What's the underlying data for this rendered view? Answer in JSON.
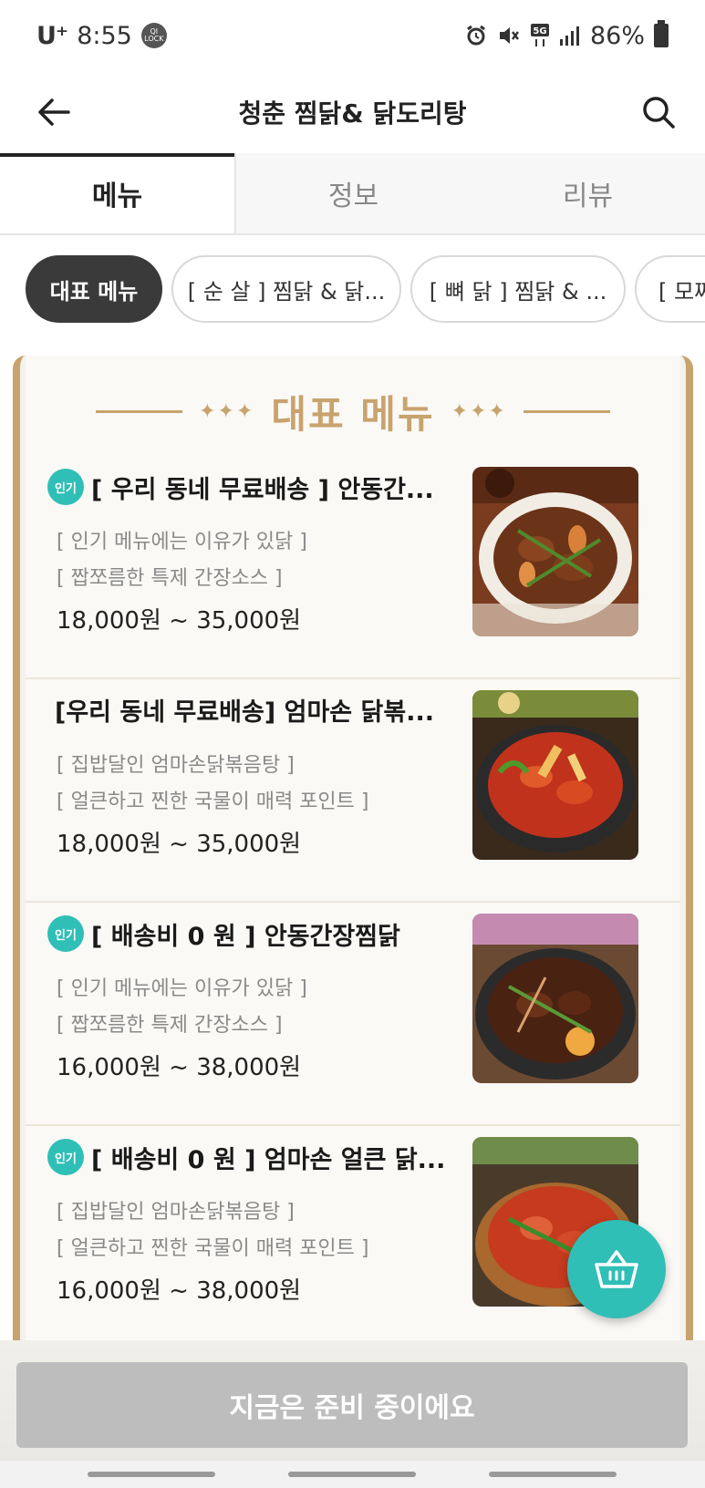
{
  "status_bar": {
    "carrier": "U⁺",
    "time": "8:55",
    "lock_badge": "QI LOCK",
    "network": "5G",
    "battery": "86%"
  },
  "header": {
    "title": "청춘 찜닭& 닭도리탕"
  },
  "tabs": [
    {
      "label": "메뉴",
      "active": true
    },
    {
      "label": "정보",
      "active": false
    },
    {
      "label": "리뷰",
      "active": false
    }
  ],
  "categories": [
    {
      "label": "대표 메뉴",
      "active": true
    },
    {
      "label": "[ 순 살 ] 찜닭 & 닭...",
      "active": false
    },
    {
      "label": "[ 뼈 닭 ] 찜닭 & ...",
      "active": false
    },
    {
      "label": "[ 모짜",
      "active": false
    }
  ],
  "section_title": "대표 메뉴",
  "menu_items": [
    {
      "badge": "인기",
      "name": "[ 우리 동네 무료배송 ] 안동간...",
      "desc1": "[ 인기 메뉴에는 이유가 있닭 ]",
      "desc2": "[ 짭쪼름한 특제 간장소스 ]",
      "price": "18,000원 ~ 35,000원"
    },
    {
      "badge": "",
      "name": "[우리 동네 무료배송] 엄마손 닭볶...",
      "desc1": "[ 집밥달인 엄마손닭볶음탕 ]",
      "desc2": "[ 얼큰하고 찐한 국물이 매력 포인트 ]",
      "price": "18,000원 ~ 35,000원"
    },
    {
      "badge": "인기",
      "name": "[ 배송비 0 원 ] 안동간장찜닭",
      "desc1": "[ 인기 메뉴에는 이유가 있닭 ]",
      "desc2": "[ 짭쪼름한 특제 간장소스 ]",
      "price": "16,000원 ~ 38,000원"
    },
    {
      "badge": "인기",
      "name": "[ 배송비 0 원 ] 엄마손 얼큰 닭...",
      "desc1": "[ 집밥달인 엄마손닭볶음탕 ]",
      "desc2": "[ 얼큰하고 찐한 국물이 매력 포인트 ]",
      "price": "16,000원 ~ 38,000원"
    }
  ],
  "bottom_button": "지금은 준비 중이에요",
  "colors": {
    "accent": "#2fbfb7",
    "gold": "#c9a36d",
    "disabled": "#bdbdbd"
  }
}
